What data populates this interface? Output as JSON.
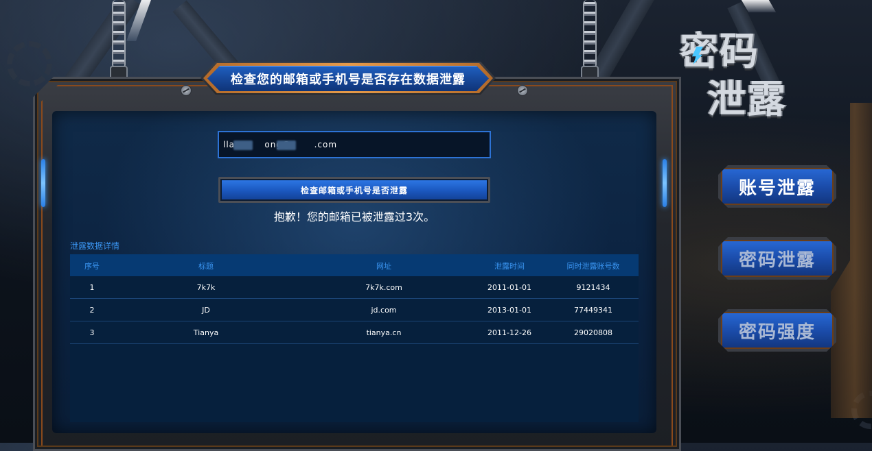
{
  "header": {
    "title": "检查您的邮箱或手机号是否存在数据泄露"
  },
  "logo": {
    "line1": "密码",
    "line2": "泄露"
  },
  "search": {
    "value": "lla         ong@       .com",
    "button_label": "检查邮箱或手机号是否泄露"
  },
  "result": {
    "message": "抱歉！您的邮箱已被泄露过3次。"
  },
  "details": {
    "label": "泄露数据详情",
    "columns": [
      "序号",
      "标题",
      "网址",
      "泄露时间",
      "同时泄露账号数"
    ],
    "rows": [
      {
        "index": "1",
        "title": "7k7k",
        "url": "7k7k.com",
        "date": "2011-01-01",
        "count": "9121434"
      },
      {
        "index": "2",
        "title": "JD",
        "url": "jd.com",
        "date": "2013-01-01",
        "count": "77449341"
      },
      {
        "index": "3",
        "title": "Tianya",
        "url": "tianya.cn",
        "date": "2011-12-26",
        "count": "29020808"
      }
    ]
  },
  "side_menu": {
    "account_leak": "账号泄露",
    "password_leak": "密码泄露",
    "password_strength": "密码强度"
  },
  "colors": {
    "accent_blue": "#2d73d6",
    "header_text_blue": "#3a94f0",
    "frame_orange": "#b36a2a"
  }
}
